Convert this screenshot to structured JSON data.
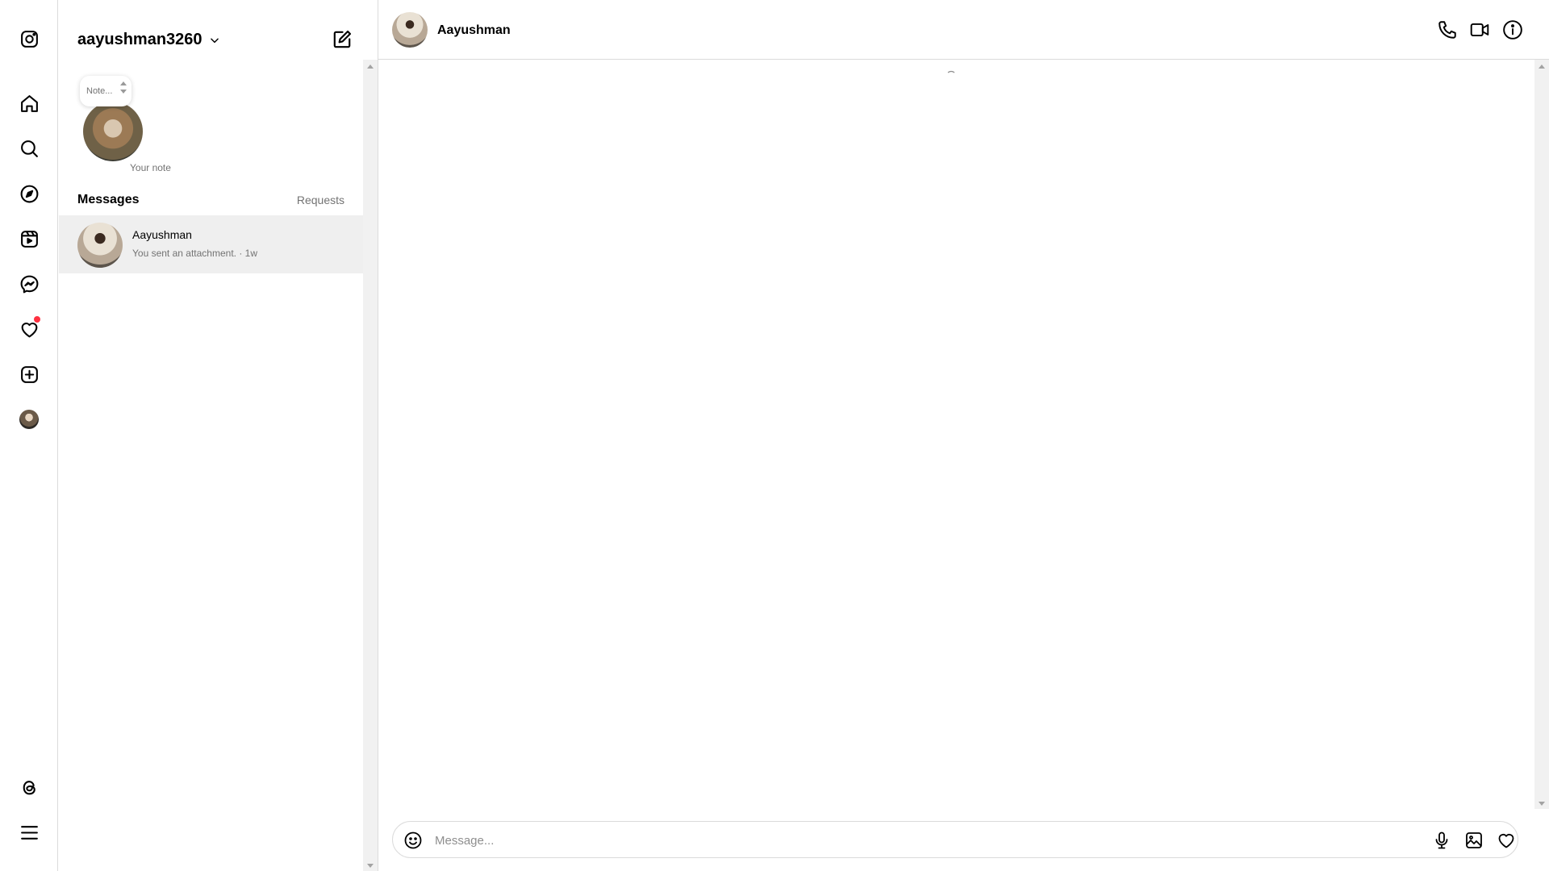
{
  "account": {
    "username": "aayushman3260"
  },
  "note": {
    "bubble_text": "Note...",
    "label": "Your note"
  },
  "messages_header": {
    "title": "Messages",
    "requests_label": "Requests"
  },
  "threads": [
    {
      "name": "Aayushman",
      "preview": "You sent an attachment. · 1w"
    }
  ],
  "chat": {
    "contact_name": "Aayushman",
    "composer_placeholder": "Message..."
  },
  "colors": {
    "notification_dot": "#ff3040",
    "selected_row": "#efefef",
    "divider": "#dbdbdb"
  },
  "nav_icons": [
    "instagram-logo-icon",
    "home-icon",
    "search-icon",
    "explore-icon",
    "reels-icon",
    "messenger-icon",
    "notifications-heart-icon",
    "create-icon",
    "profile-avatar",
    "threads-icon",
    "menu-icon"
  ]
}
